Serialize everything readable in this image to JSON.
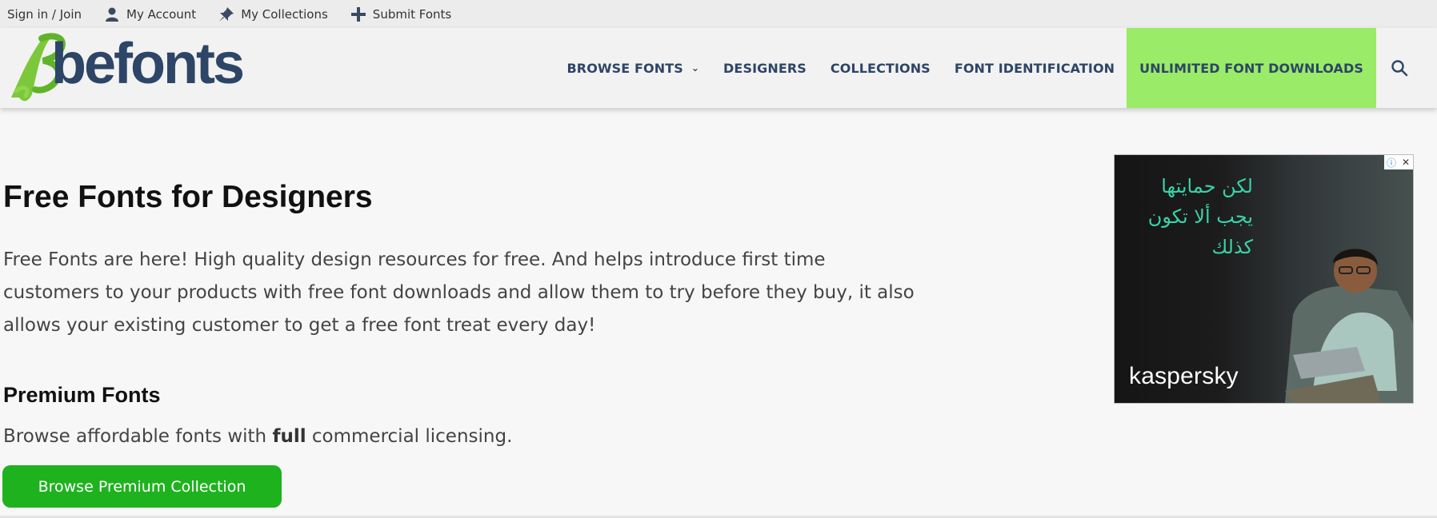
{
  "topbar": {
    "signin": "Sign in / Join",
    "account": "My Account",
    "collections": "My Collections",
    "submit": "Submit Fonts"
  },
  "logo": {
    "text": "befonts"
  },
  "nav": {
    "browse": "BROWSE FONTS",
    "designers": "DESIGNERS",
    "collections": "COLLECTIONS",
    "identification": "FONT IDENTIFICATION",
    "unlimited": "UNLIMITED FONT DOWNLOADS"
  },
  "main": {
    "title": "Free Fonts for Designers",
    "intro": "Free Fonts are here! High quality design resources for free. And helps introduce first time customers to your products with free font downloads and allow them to try before they buy, it also allows your existing customer to get a free font treat every day!",
    "premium_title": "Premium Fonts",
    "premium_text_before": "Browse affordable fonts with ",
    "premium_text_bold": "full",
    "premium_text_after": " commercial licensing.",
    "button": "Browse Premium Collection"
  },
  "ad": {
    "arabic_line1": "لكن حمايتها",
    "arabic_line2": "يجب ألا تكون",
    "arabic_line3": "كذلك",
    "brand": "kaspersky",
    "info_icon": "ⓘ",
    "close_icon": "✕"
  },
  "colors": {
    "brand_navy": "#2d4566",
    "cta_green": "#9aeb68",
    "button_green": "#1fb21f",
    "ad_teal": "#39d3a7"
  }
}
